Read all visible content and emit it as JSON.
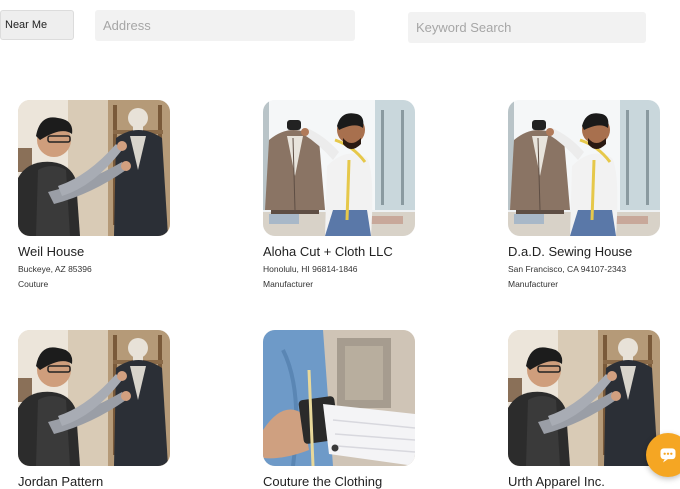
{
  "search": {
    "near_me_label": "Near Me",
    "address_placeholder": "Address",
    "keyword_placeholder": "Keyword Search"
  },
  "listings": [
    {
      "name": "Weil House",
      "location": "Buckeye, AZ 85396",
      "category": "Couture",
      "photo": "tailor-mannequin"
    },
    {
      "name": "Aloha Cut + Cloth LLC",
      "location": "Honolulu, HI 96814-1846",
      "category": "Manufacturer",
      "photo": "tailor-measuring"
    },
    {
      "name": "D.a.D. Sewing House",
      "location": "San Francisco, CA 94107-2343",
      "category": "Manufacturer",
      "photo": "tailor-measuring"
    },
    {
      "name": "Jordan Pattern",
      "location": "",
      "category": "",
      "photo": "tailor-mannequin"
    },
    {
      "name": "Couture the Clothing",
      "location": "",
      "category": "",
      "photo": "tailor-sleeve"
    },
    {
      "name": "Urth Apparel Inc.",
      "location": "",
      "category": "",
      "photo": "tailor-mannequin"
    }
  ],
  "chat": {
    "icon": "chat-bubble-icon",
    "color": "#f5a623"
  }
}
